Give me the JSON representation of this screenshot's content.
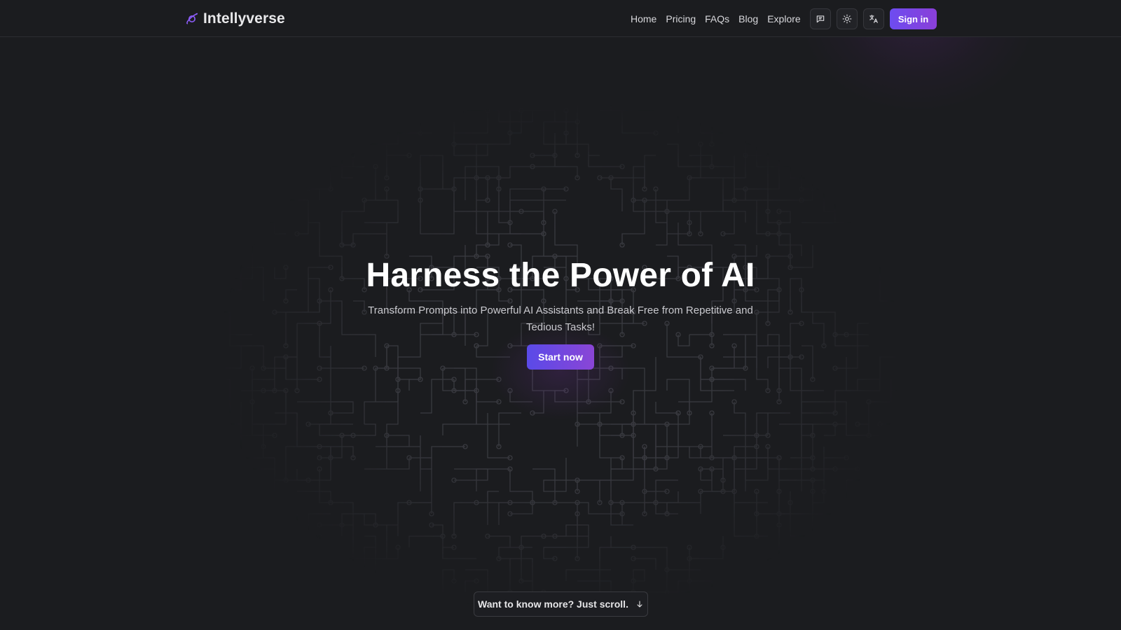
{
  "header": {
    "brand_name": "Intellyverse",
    "brand_icon": "planet-icon",
    "nav": [
      {
        "label": "Home"
      },
      {
        "label": "Pricing"
      },
      {
        "label": "FAQs"
      },
      {
        "label": "Blog"
      },
      {
        "label": "Explore"
      }
    ],
    "icons": [
      "chat-icon",
      "sun-icon",
      "translate-icon"
    ],
    "signin_label": "Sign in"
  },
  "hero": {
    "title": "Harness the Power of AI",
    "subtitle": "Transform Prompts into Powerful AI Assistants and Break Free from Repetitive and Tedious Tasks!",
    "cta_label": "Start now"
  },
  "scroll_hint": {
    "label": "Want to know more? Just scroll.",
    "icon": "arrow-down-icon"
  },
  "colors": {
    "background": "#1b1c1f",
    "accent_start": "#5a4ae8",
    "accent_end": "#8a45d6",
    "brand_icon": "#8b5cf6"
  }
}
